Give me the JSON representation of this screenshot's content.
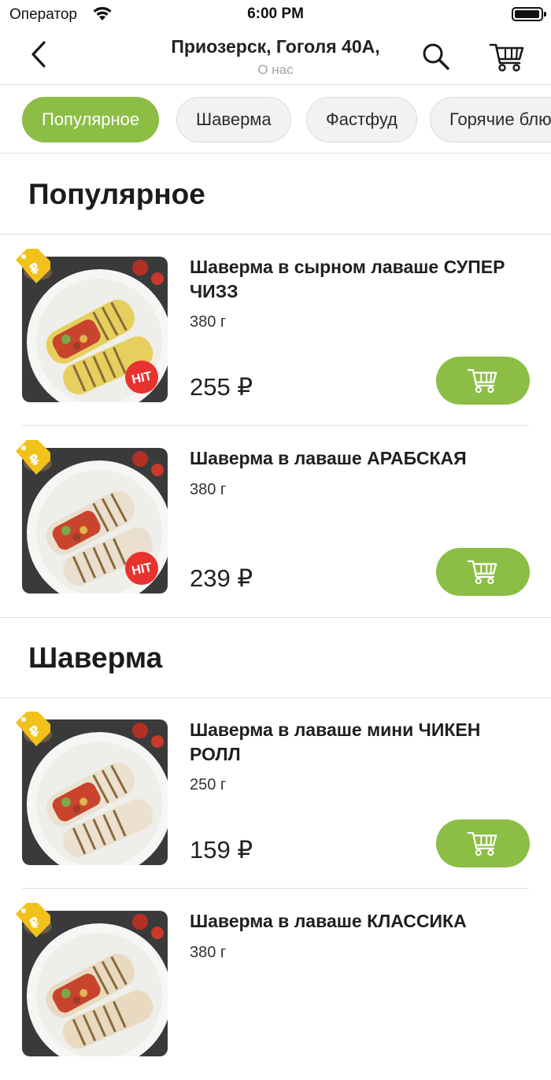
{
  "status": {
    "carrier": "Оператор",
    "time": "6:00 PM"
  },
  "header": {
    "title": "Приозерск, Гоголя 40А,",
    "subtitle": "О нас"
  },
  "categories": [
    {
      "label": "Популярное",
      "active": true
    },
    {
      "label": "Шаверма",
      "active": false
    },
    {
      "label": "Фастфуд",
      "active": false
    },
    {
      "label": "Горячие блюда",
      "active": false
    }
  ],
  "sections": [
    {
      "title": "Популярное",
      "items": [
        {
          "name": "Шаверма в сырном лаваше СУПЕР ЧИЗЗ",
          "weight": "380 г",
          "price": "255 ₽",
          "badge": "HIT",
          "wrap_color": "#e6cf5c"
        },
        {
          "name": "Шаверма в лаваше АРАБСКАЯ",
          "weight": "380 г",
          "price": "239 ₽",
          "badge": "HIT",
          "wrap_color": "#eadfcf"
        }
      ]
    },
    {
      "title": "Шаверма",
      "items": [
        {
          "name": "Шаверма в лаваше мини ЧИКЕН РОЛЛ",
          "weight": "250 г",
          "price": "159 ₽",
          "badge": "",
          "wrap_color": "#ece1cf"
        },
        {
          "name": "Шаверма в лаваше КЛАССИКА",
          "weight": "380 г",
          "price": "",
          "badge": "",
          "wrap_color": "#e8d9c0"
        }
      ]
    }
  ],
  "icons": {
    "back": "chevron-left-icon",
    "search": "search-icon",
    "cart": "cart-icon",
    "tag": "discount-tag-icon"
  },
  "colors": {
    "accent": "#8cbe45",
    "tag": "#f2c21b",
    "hit_badge": "#e8322f"
  }
}
